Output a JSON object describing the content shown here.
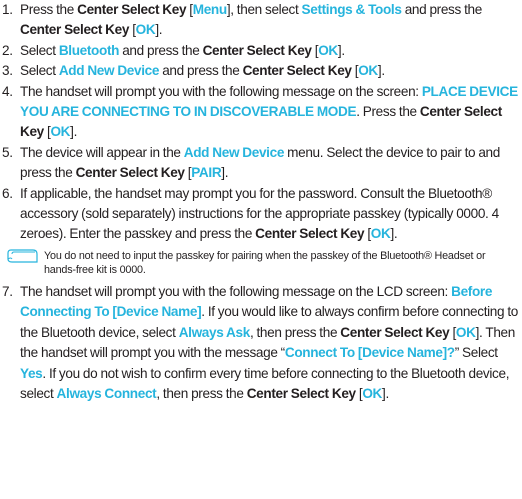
{
  "steps": [
    {
      "num": "1.",
      "segments": [
        {
          "t": "Press the ",
          "s": "plain"
        },
        {
          "t": "Center Select Key",
          "s": "bold"
        },
        {
          "t": " [",
          "s": "plain"
        },
        {
          "t": "Menu",
          "s": "hl"
        },
        {
          "t": "], then select ",
          "s": "plain"
        },
        {
          "t": "Settings & Tools",
          "s": "hl"
        },
        {
          "t": " and press the ",
          "s": "plain"
        },
        {
          "t": "Center Select Key",
          "s": "bold"
        },
        {
          "t": " [",
          "s": "plain"
        },
        {
          "t": "OK",
          "s": "hl"
        },
        {
          "t": "].",
          "s": "plain"
        }
      ]
    },
    {
      "num": "2.",
      "segments": [
        {
          "t": "Select ",
          "s": "plain"
        },
        {
          "t": "Bluetooth",
          "s": "hl"
        },
        {
          "t": " and press the ",
          "s": "plain"
        },
        {
          "t": "Center Select Key",
          "s": "bold"
        },
        {
          "t": " [",
          "s": "plain"
        },
        {
          "t": "OK",
          "s": "hl"
        },
        {
          "t": "].",
          "s": "plain"
        }
      ]
    },
    {
      "num": "3.",
      "segments": [
        {
          "t": "Select ",
          "s": "plain"
        },
        {
          "t": "Add New Device",
          "s": "hl"
        },
        {
          "t": " and press the ",
          "s": "plain"
        },
        {
          "t": "Center Select Key",
          "s": "bold"
        },
        {
          "t": " [",
          "s": "plain"
        },
        {
          "t": "OK",
          "s": "hl"
        },
        {
          "t": "].",
          "s": "plain"
        }
      ]
    },
    {
      "num": "4.",
      "segments": [
        {
          "t": "The handset will prompt you with the following message on the screen: ",
          "s": "plain"
        },
        {
          "t": "PLACE DEVICE YOU ARE CONNECTING TO IN DISCOVERABLE MODE",
          "s": "hl"
        },
        {
          "t": ". Press the ",
          "s": "plain"
        },
        {
          "t": "Center Select Key",
          "s": "bold"
        },
        {
          "t": " [",
          "s": "plain"
        },
        {
          "t": "OK",
          "s": "hl"
        },
        {
          "t": "].",
          "s": "plain"
        }
      ]
    },
    {
      "num": "5.",
      "segments": [
        {
          "t": "The device will appear in the ",
          "s": "plain"
        },
        {
          "t": "Add New Device",
          "s": "hl"
        },
        {
          "t": " menu. Select the device to pair to and press the ",
          "s": "plain"
        },
        {
          "t": "Center Select Key",
          "s": "bold"
        },
        {
          "t": " [",
          "s": "plain"
        },
        {
          "t": "PAIR",
          "s": "hl"
        },
        {
          "t": "].",
          "s": "plain"
        }
      ]
    },
    {
      "num": "6.",
      "segments": [
        {
          "t": "If applicable, the handset may prompt you for the password. Consult the Bluetooth® accessory (sold separately) instructions for the appropriate passkey (typically 0000. 4 zeroes). Enter the passkey and press the ",
          "s": "plain"
        },
        {
          "t": "Center Select Key",
          "s": "bold"
        },
        {
          "t": " [",
          "s": "plain"
        },
        {
          "t": "OK",
          "s": "hl"
        },
        {
          "t": "].",
          "s": "plain"
        }
      ]
    }
  ],
  "note": {
    "icon": "note-icon",
    "text": "You do not need to input the passkey for pairing when the passkey of the Bluetooth® Headset or hands-free kit is 0000."
  },
  "steps_after": [
    {
      "num": "7.",
      "segments": [
        {
          "t": "The handset will prompt you with the following message on the LCD screen: ",
          "s": "plain"
        },
        {
          "t": "Before Connecting To [Device Name]",
          "s": "hl"
        },
        {
          "t": ". If you would like to always confirm before connecting to the Bluetooth device, select ",
          "s": "plain"
        },
        {
          "t": "Always Ask",
          "s": "hl"
        },
        {
          "t": ", then press the ",
          "s": "plain"
        },
        {
          "t": "Center Select Key",
          "s": "bold"
        },
        {
          "t": " [",
          "s": "plain"
        },
        {
          "t": "OK",
          "s": "hl"
        },
        {
          "t": "]. Then the handset will prompt you with the message “",
          "s": "plain"
        },
        {
          "t": "Connect To [Device Name]?",
          "s": "hl"
        },
        {
          "t": "” Select ",
          "s": "plain"
        },
        {
          "t": "Yes",
          "s": "hl"
        },
        {
          "t": ". If you do not wish to confirm every time before connecting to the Bluetooth device, select ",
          "s": "plain"
        },
        {
          "t": "Always Connect",
          "s": "hl"
        },
        {
          "t": ", then press the ",
          "s": "plain"
        },
        {
          "t": "Center Select Key",
          "s": "bold"
        },
        {
          "t": " [",
          "s": "plain"
        },
        {
          "t": "OK",
          "s": "hl"
        },
        {
          "t": "].",
          "s": "plain"
        }
      ]
    }
  ],
  "colors": {
    "highlight": "#26b4dd",
    "text": "#231f20"
  }
}
